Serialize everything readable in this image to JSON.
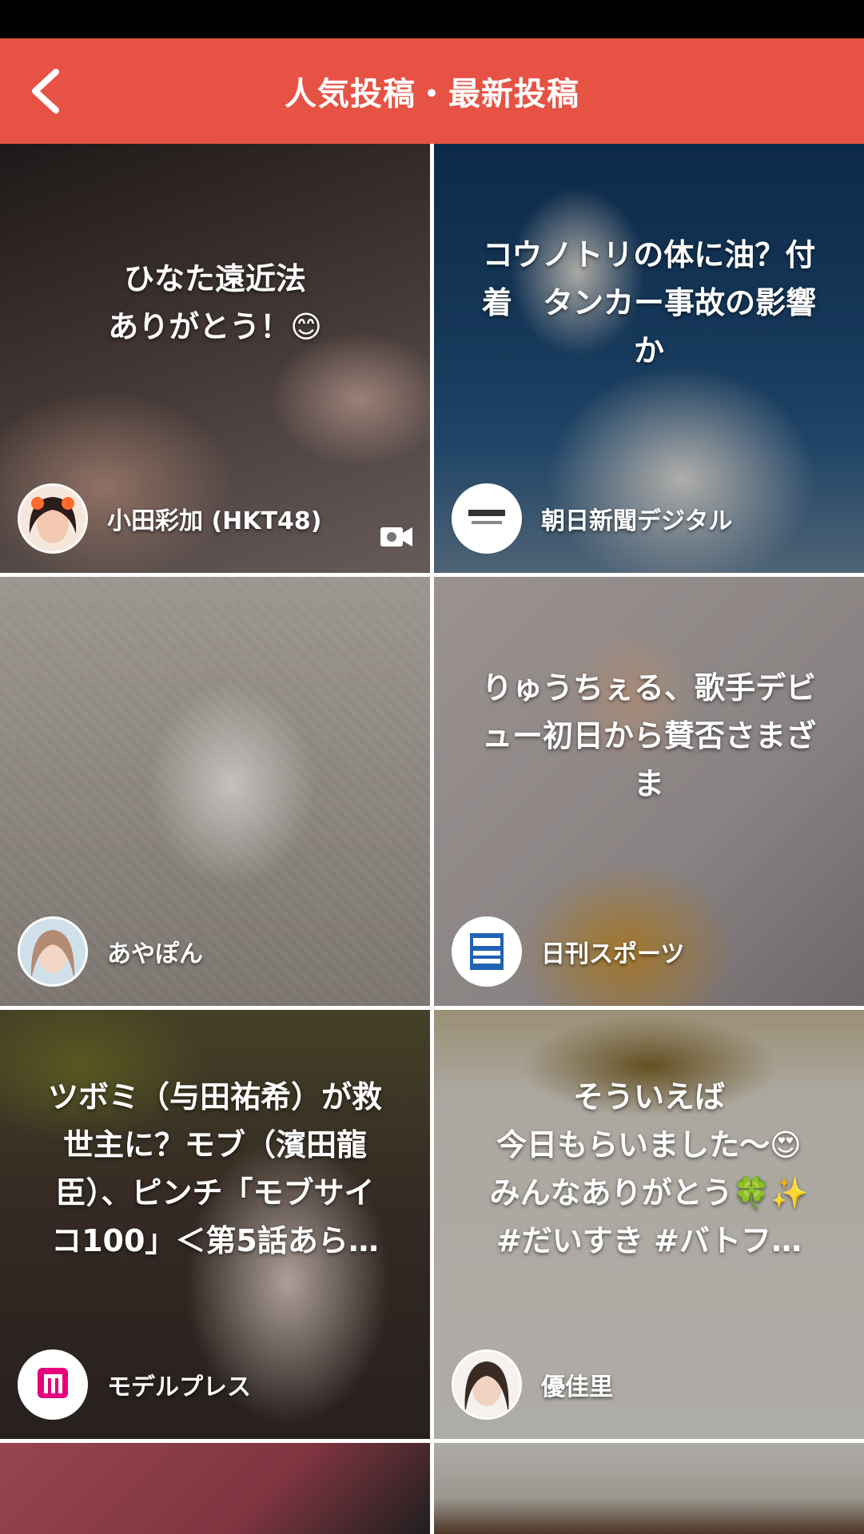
{
  "header": {
    "title": "人気投稿・最新投稿",
    "back_icon": "chevron-left-icon",
    "background": "#e65244"
  },
  "posts": [
    {
      "caption": "ひなた遠近法\nありがとう！😊",
      "author": "小田彩加 (HKT48)",
      "has_video": true
    },
    {
      "caption": "コウノトリの体に油？付\n着　タンカー事故の影響\nか",
      "author": "朝日新聞デジタル",
      "has_video": false
    },
    {
      "caption": "",
      "author": "あやぽん",
      "has_video": false
    },
    {
      "caption": "りゅうちぇる、歌手デビ\nュー初日から賛否さまざ\nま",
      "author": "日刊スポーツ",
      "has_video": false
    },
    {
      "caption": "ツボミ（与田祐希）が救\n世主に？モブ（濱田龍\n臣）、ピンチ「モブサイ\nコ100」＜第5話あら…",
      "author": "モデルプレス",
      "has_video": false
    },
    {
      "caption": "そういえば\n今日もらいました〜😍\nみんなありがとう🍀✨\n#だいすき #バトフ…",
      "author": "優佳里",
      "has_video": false
    }
  ]
}
